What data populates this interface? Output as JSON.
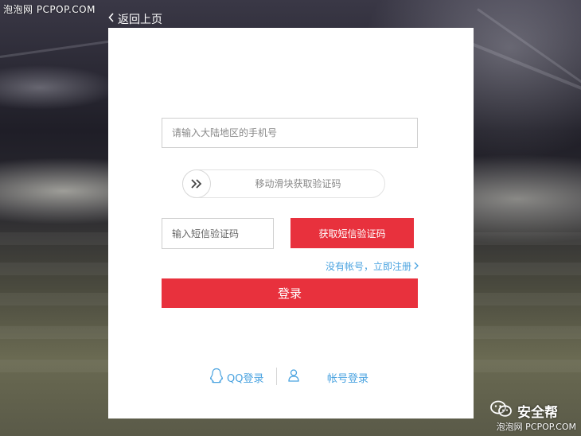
{
  "watermarks": {
    "top": "泡泡网 PCPOP.COM",
    "bottom": "泡泡网 PCPOP.COM"
  },
  "wechat_badge": {
    "name": "安全帮",
    "icon": "wechat-icon"
  },
  "header": {
    "back_label": "返回上页",
    "back_icon": "chevron-left-icon"
  },
  "form": {
    "phone_placeholder": "请输入大陆地区的手机号",
    "slider_text": "移动滑块获取验证码",
    "slider_icon": "double-chevron-right-icon",
    "sms_placeholder": "输入短信验证码",
    "sms_button_label": "获取短信验证码",
    "register_link": "没有帐号，立即注册",
    "login_button_label": "登录"
  },
  "alt_logins": {
    "qq_label": "QQ登录",
    "qq_icon": "qq-penguin-icon",
    "account_icon": "user-icon",
    "account_label": "帐号登录"
  },
  "colors": {
    "accent_red": "#e8313d",
    "link_blue": "#4aa3e0",
    "card_bg": "#ffffff"
  }
}
